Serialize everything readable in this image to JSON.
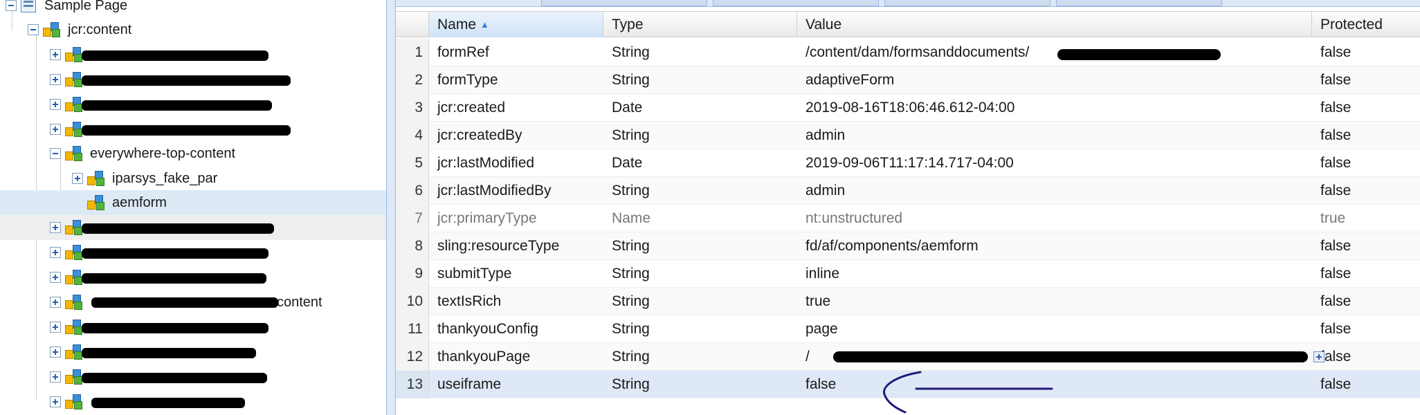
{
  "tree": {
    "root_label": "Sample Page",
    "items": [
      {
        "label": "jcr:content"
      },
      {
        "label": ""
      },
      {
        "label": ""
      },
      {
        "label": ""
      },
      {
        "label": ""
      },
      {
        "label": "everywhere-top-content"
      },
      {
        "label": "iparsys_fake_par"
      },
      {
        "label": "aemform"
      },
      {
        "label": ""
      },
      {
        "label": ""
      },
      {
        "label": ""
      },
      {
        "label": "content"
      },
      {
        "label": ""
      },
      {
        "label": ""
      },
      {
        "label": ""
      },
      {
        "label": ""
      }
    ]
  },
  "grid": {
    "columns": {
      "name": "Name",
      "type": "Type",
      "value": "Value",
      "protected": "Protected"
    },
    "rows": [
      {
        "num": "1",
        "name": "formRef",
        "type": "String",
        "value": "/content/dam/formsanddocuments/",
        "protected": "false"
      },
      {
        "num": "2",
        "name": "formType",
        "type": "String",
        "value": "adaptiveForm",
        "protected": "false"
      },
      {
        "num": "3",
        "name": "jcr:created",
        "type": "Date",
        "value": "2019-08-16T18:06:46.612-04:00",
        "protected": "false"
      },
      {
        "num": "4",
        "name": "jcr:createdBy",
        "type": "String",
        "value": "admin",
        "protected": "false"
      },
      {
        "num": "5",
        "name": "jcr:lastModified",
        "type": "Date",
        "value": "2019-09-06T11:17:14.717-04:00",
        "protected": "false"
      },
      {
        "num": "6",
        "name": "jcr:lastModifiedBy",
        "type": "String",
        "value": "admin",
        "protected": "false"
      },
      {
        "num": "7",
        "name": "jcr:primaryType",
        "type": "Name",
        "value": "nt:unstructured",
        "protected": "true"
      },
      {
        "num": "8",
        "name": "sling:resourceType",
        "type": "String",
        "value": "fd/af/components/aemform",
        "protected": "false"
      },
      {
        "num": "9",
        "name": "submitType",
        "type": "String",
        "value": "inline",
        "protected": "false"
      },
      {
        "num": "10",
        "name": "textIsRich",
        "type": "String",
        "value": "true",
        "protected": "false"
      },
      {
        "num": "11",
        "name": "thankyouConfig",
        "type": "String",
        "value": "page",
        "protected": "false"
      },
      {
        "num": "12",
        "name": "thankyouPage",
        "type": "String",
        "value": "/",
        "protected": "false"
      },
      {
        "num": "13",
        "name": "useiframe",
        "type": "String",
        "value": "false",
        "protected": "false"
      }
    ]
  },
  "colors": {
    "accent": "#3b7bd4",
    "selection": "#dfe8f6",
    "annotation": "#1f1a7a"
  }
}
